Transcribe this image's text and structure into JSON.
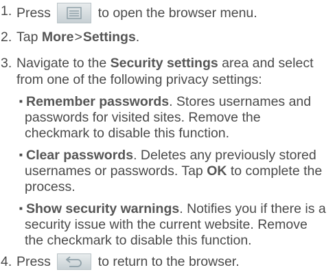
{
  "steps": [
    {
      "num": "1.",
      "pre": "Press",
      "icon": "menu-key-icon",
      "post": "to open the browser menu."
    },
    {
      "num": "2.",
      "pre": "Tap",
      "bold1": "More",
      "sep": ">",
      "bold2": "Settings",
      "end": "."
    },
    {
      "num": "3.",
      "pre": "Navigate to the",
      "bold": "Security settings",
      "post": "area and select",
      "line2": "from one of the following privacy settings:"
    },
    {
      "num": "4.",
      "pre": "Press",
      "icon": "back-key-icon",
      "post": "to return to the browser."
    }
  ],
  "bullets": [
    {
      "title": "Remember passwords",
      "l1": ". Stores usernames and",
      "l2": "passwords for visited sites. Remove the",
      "l3": "checkmark to disable this function."
    },
    {
      "title": "Clear passwords",
      "l1": ". Deletes any previously stored",
      "l2": "usernames or passwords. Tap",
      "ok": "OK",
      "l2b": "to complete the",
      "l3": "process."
    },
    {
      "title": "Show security warnings",
      "l1": ". Notifies you if there is a",
      "l2": "security issue with the current website. Remove",
      "l3": "the checkmark to disable this function."
    }
  ]
}
